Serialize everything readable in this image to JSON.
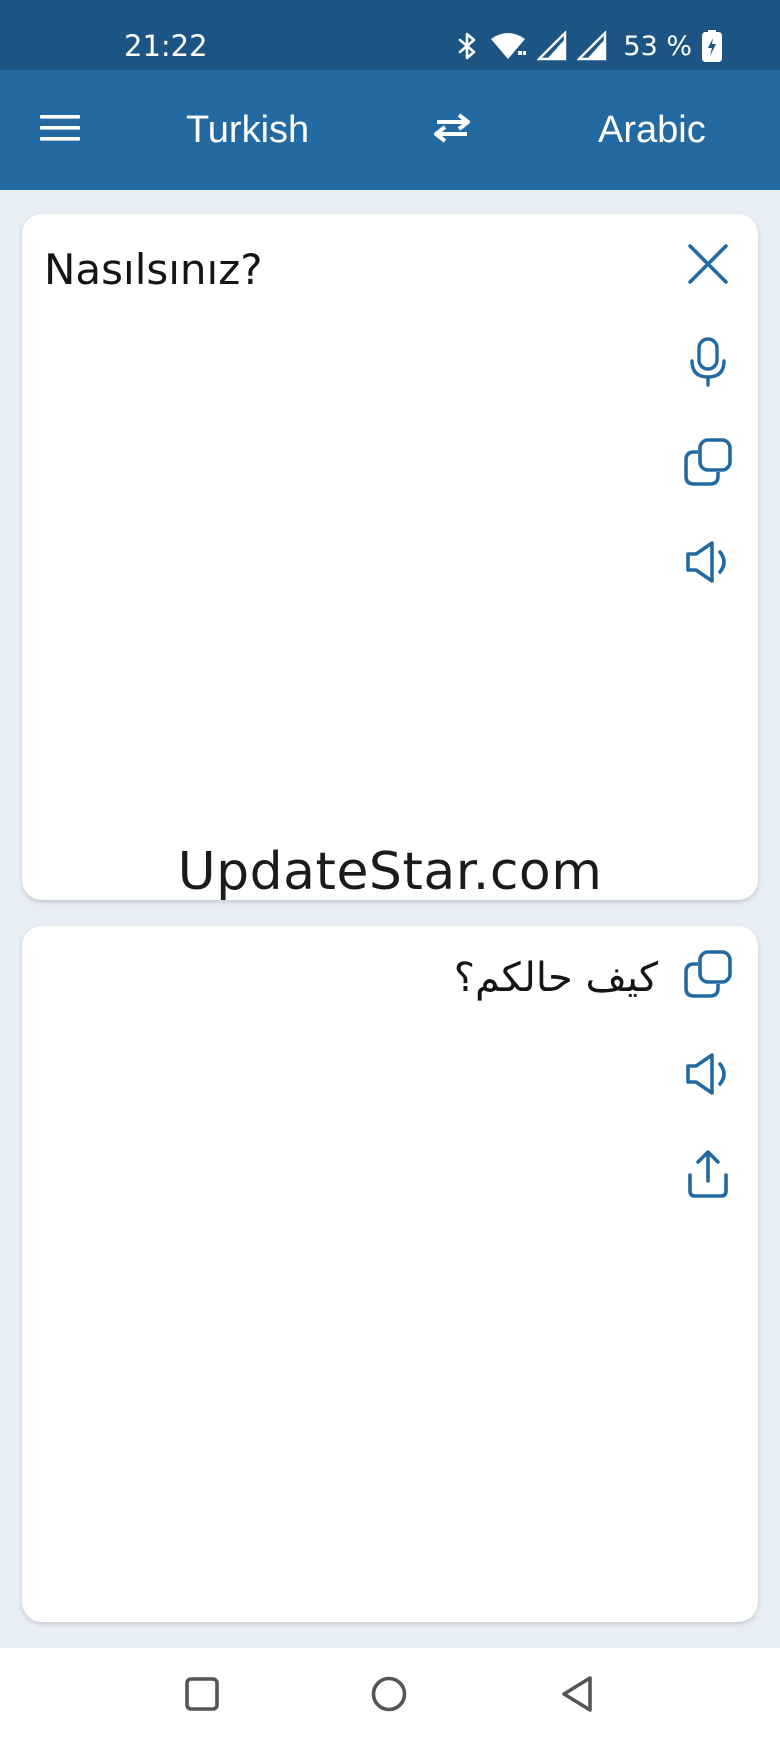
{
  "status_bar": {
    "time": "21:22",
    "battery": "53 %",
    "icons": [
      "bluetooth-icon",
      "wifi-icon",
      "signal-icon",
      "signal-icon",
      "battery-charging-icon"
    ]
  },
  "app_bar": {
    "menu_icon": "hamburger-menu-icon",
    "source_language": "Turkish",
    "swap_icon": "swap-arrows-icon",
    "target_language": "Arabic"
  },
  "input_card": {
    "text": "Nasılsınız?",
    "actions": [
      "close-icon",
      "microphone-icon",
      "copy-icon",
      "speaker-icon"
    ]
  },
  "output_card": {
    "text": "كيف حالكم؟",
    "actions": [
      "copy-icon",
      "speaker-icon",
      "share-icon"
    ]
  },
  "watermark": "UpdateStar.com",
  "nav_bar": {
    "buttons": [
      "recents-square-icon",
      "home-circle-icon",
      "back-triangle-icon"
    ]
  },
  "colors": {
    "status_bar": "#1c5484",
    "app_bar": "#236aa2",
    "accent_icon": "#236aa2",
    "background": "#e8eef5"
  }
}
